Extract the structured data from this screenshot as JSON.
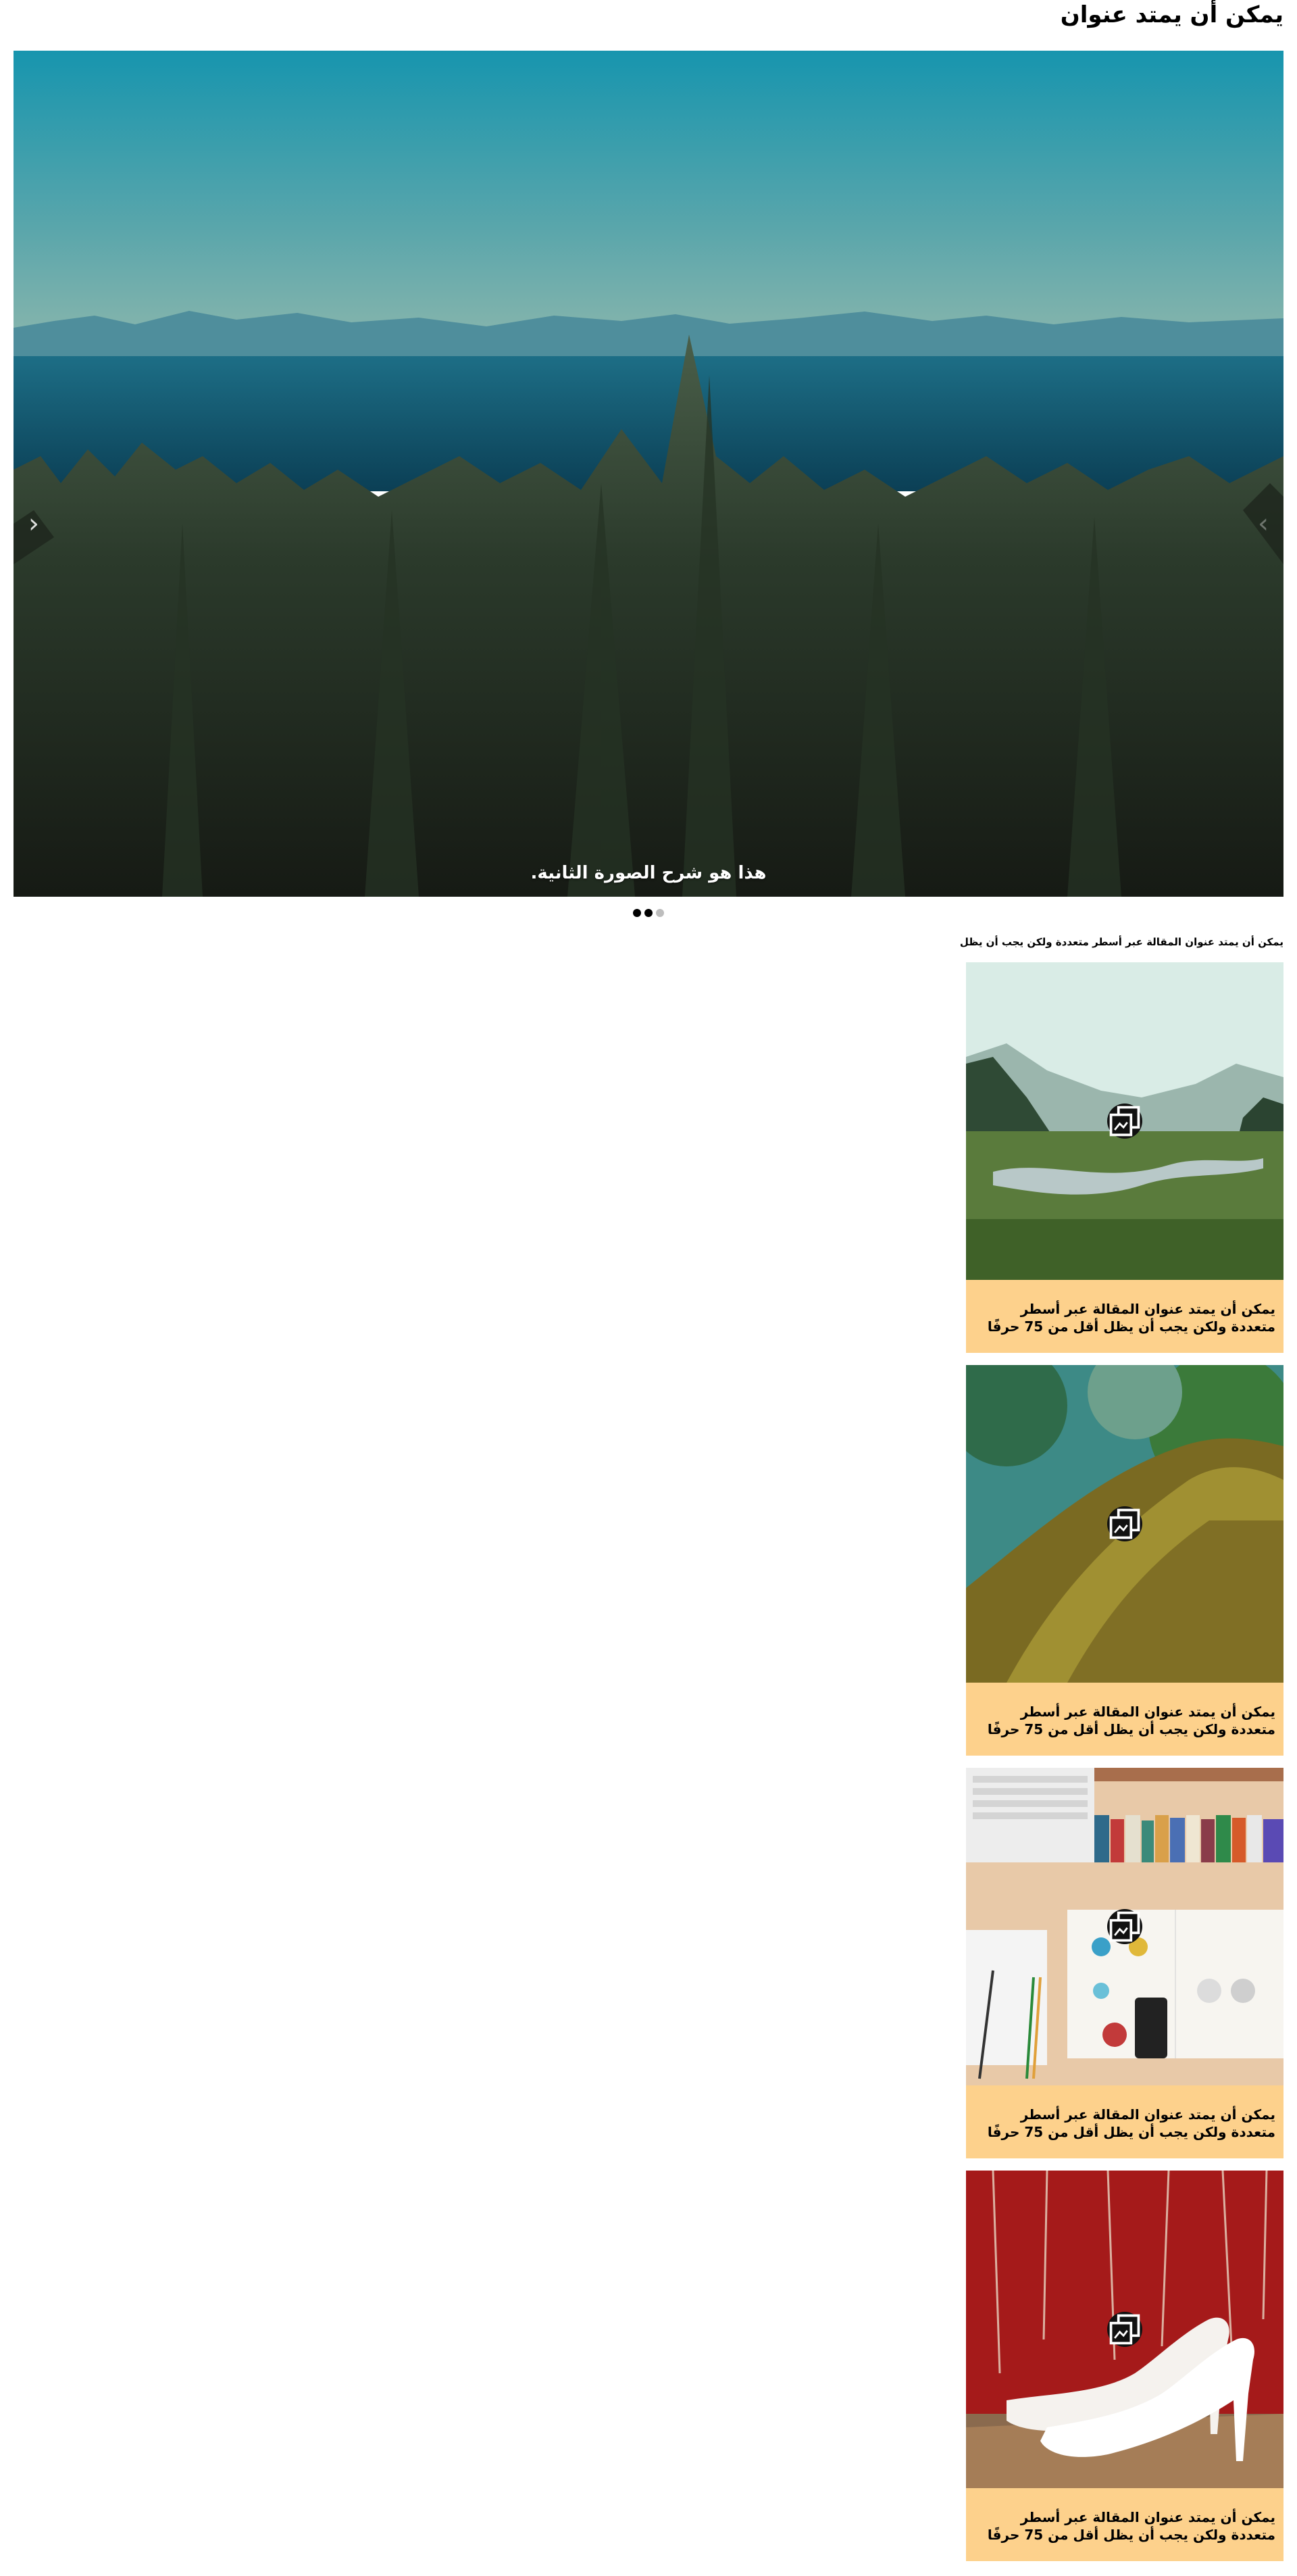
{
  "page": {
    "title": "يمكن أن يمتد عنوان"
  },
  "slider": {
    "caption": "هذا هو شرح الصورة الثانية.",
    "prev_icon": "chevron-left-icon",
    "next_icon": "chevron-right-icon",
    "dots": [
      {
        "state": "active"
      },
      {
        "state": "active"
      },
      {
        "state": "inactive"
      }
    ]
  },
  "section": {
    "heading": "يمكن أن يمتد عنوان المقالة عبر أسطر متعددة ولكن يجب أن يظل"
  },
  "cards": [
    {
      "image": "river-valley-photo",
      "badge_icon": "gallery-icon",
      "title": "يمكن أن يمتد عنوان المقالة عبر أسطر\nمتعددة ولكن يجب أن يظل أقل من 75 حرفًا"
    },
    {
      "image": "mossy-tree-photo",
      "badge_icon": "gallery-icon",
      "title": "يمكن أن يمتد عنوان المقالة عبر أسطر\nمتعددة ولكن يجب أن يظل أقل من 75 حرفًا"
    },
    {
      "image": "desk-workspace-photo",
      "badge_icon": "gallery-icon",
      "title": "يمكن أن يمتد عنوان المقالة عبر أسطر\nمتعددة ولكن يجب أن يظل أقل من 75 حرفًا"
    },
    {
      "image": "white-heels-photo",
      "badge_icon": "gallery-icon",
      "title": "يمكن أن يمتد عنوان المقالة عبر أسطر\nمتعددة ولكن يجب أن يظل أقل من 75 حرفًا"
    }
  ]
}
